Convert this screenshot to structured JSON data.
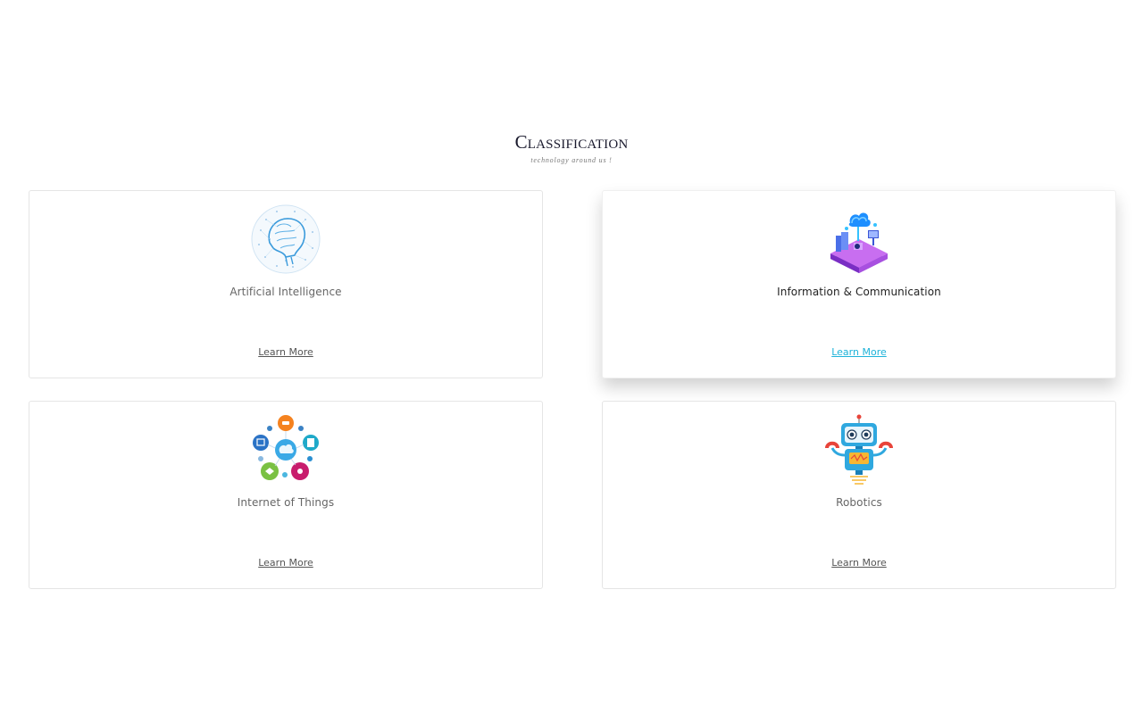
{
  "header": {
    "title": "Classification",
    "subtitle": "technology around us !"
  },
  "cards": [
    {
      "title": "Artificial Intelligence",
      "link": "Learn More",
      "icon": "brain-network-icon"
    },
    {
      "title": "Information & Communication",
      "link": "Learn More",
      "icon": "isometric-workstation-icon",
      "active": true
    },
    {
      "title": "Internet of Things",
      "link": "Learn More",
      "icon": "iot-network-icon"
    },
    {
      "title": "Robotics",
      "link": "Learn More",
      "icon": "robot-icon"
    }
  ],
  "colors": {
    "accent": "#1fb3d9",
    "border": "#e5e5e5",
    "text": "#666666"
  }
}
